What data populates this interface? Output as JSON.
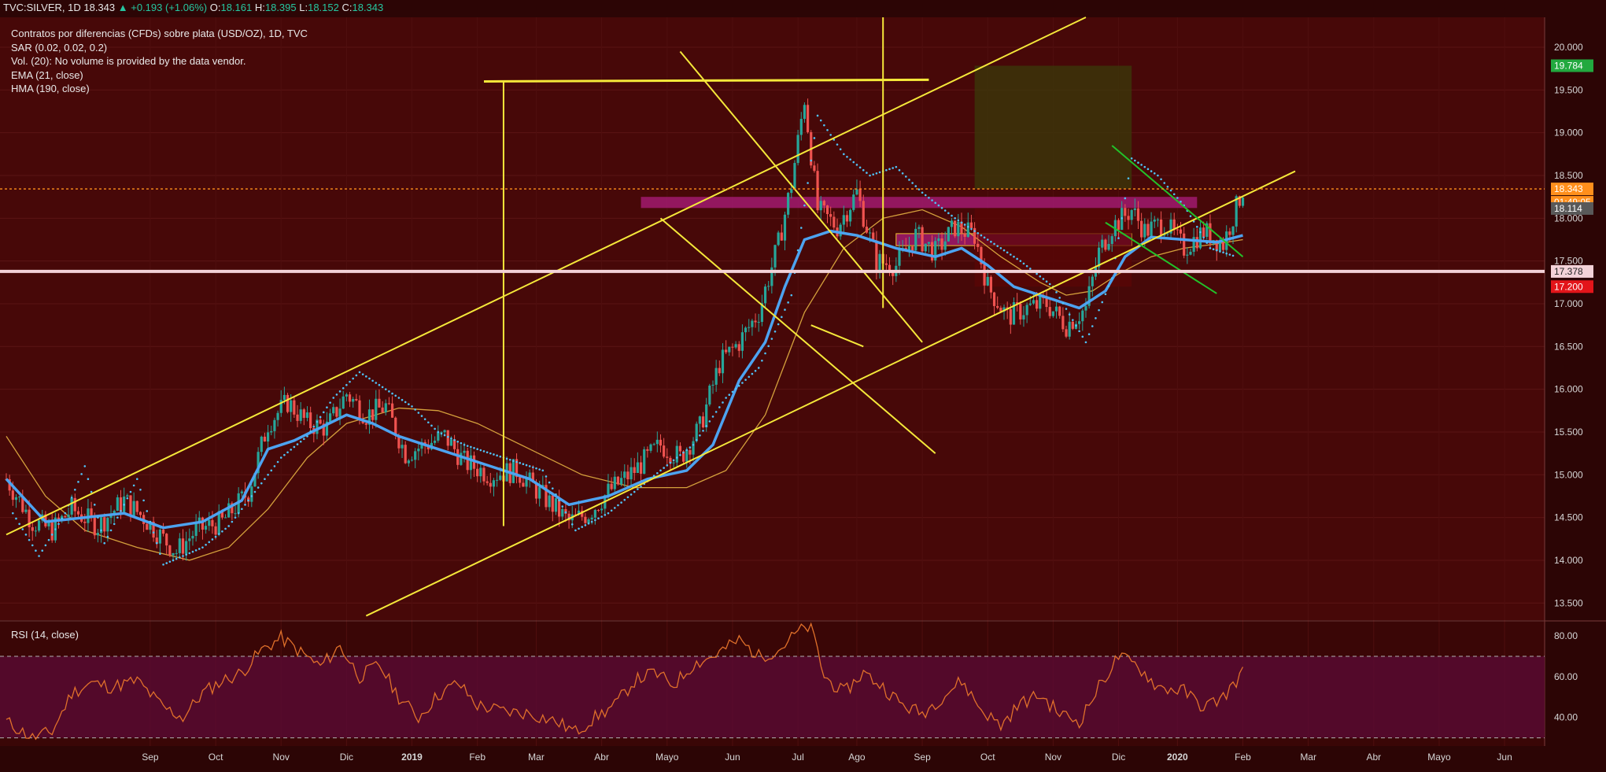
{
  "header": {
    "symbol": "TVC:SILVER, 1D",
    "last": "18.343",
    "change": "+0.193 (+1.06%)",
    "open_label": "O:",
    "open": "18.161",
    "high_label": "H:",
    "high": "18.395",
    "low_label": "L:",
    "low": "18.152",
    "close_label": "C:",
    "close": "18.343"
  },
  "legend": {
    "title": "Contratos por diferencias (CFDs) sobre plata (USD/OZ), 1D, TVC",
    "sar": "SAR (0.02, 0.02, 0.2)",
    "vol": "Vol. (20): No volume is provided by the data vendor.",
    "ema": "EMA (21, close)",
    "hma": "HMA (190, close)"
  },
  "rsi_title": "RSI (14, close)",
  "colors": {
    "background": "#2c0505",
    "up": "#26a69a",
    "down": "#ef5350",
    "ema": "#4da3f0",
    "hma": "#d4a03c",
    "sar": "#4fc3f7",
    "trendline": "#f5e83a",
    "rsi_line": "#e0702a",
    "support": "#f3d2d8"
  },
  "chart_data": [
    {
      "type": "candlestick",
      "title": "TVC:SILVER, 1D",
      "x_tick_labels": [
        "Sep",
        "Oct",
        "Nov",
        "Dic",
        "2019",
        "Feb",
        "Mar",
        "Abr",
        "Mayo",
        "Jun",
        "Jul",
        "Ago",
        "Sep",
        "Oct",
        "Nov",
        "Dic",
        "2020",
        "Feb",
        "Mar",
        "Abr",
        "Mayo",
        "Jun"
      ],
      "y_ticks": [
        "20.000",
        "19.500",
        "19.000",
        "18.500",
        "18.000",
        "17.500",
        "17.000",
        "16.500",
        "16.000",
        "15.500",
        "15.000",
        "14.500",
        "14.000",
        "13.500"
      ],
      "ylim": [
        13.3,
        20.35
      ],
      "price_markers": [
        {
          "label": "19.784",
          "value": 19.784,
          "color": "#22a93f",
          "text_color": "#ffffff"
        },
        {
          "label": "18.343",
          "value": 18.343,
          "color": "#ff8f1c",
          "text_color": "#ffffff"
        },
        {
          "label": "01:49:05",
          "value": 18.2,
          "color": "#ff8f1c",
          "text_color": "#ffffff"
        },
        {
          "label": "18.114",
          "value": 18.114,
          "color": "#595959",
          "text_color": "#ffffff"
        },
        {
          "label": "17.378",
          "value": 17.378,
          "color": "#f3d2d8",
          "text_color": "#222222"
        },
        {
          "label": "17.200",
          "value": 17.2,
          "color": "#e3151a",
          "text_color": "#ffffff"
        }
      ],
      "series": [
        {
          "name": "SAR (0.02, 0.02, 0.2)",
          "style": "dots"
        },
        {
          "name": "EMA (21, close)",
          "style": "line"
        },
        {
          "name": "HMA (190, close)",
          "style": "line"
        }
      ],
      "ohlc_path": [
        [
          0,
          14.95
        ],
        [
          4,
          14.45
        ],
        [
          7,
          14.35
        ],
        [
          10,
          14.6
        ],
        [
          14,
          14.4
        ],
        [
          18,
          14.7
        ],
        [
          21,
          14.5
        ],
        [
          24,
          14.25
        ],
        [
          26,
          14.1
        ],
        [
          29,
          14.35
        ],
        [
          33,
          14.45
        ],
        [
          37,
          14.8
        ],
        [
          40,
          15.6
        ],
        [
          43,
          15.85
        ],
        [
          46,
          15.6
        ],
        [
          49,
          15.55
        ],
        [
          52,
          15.95
        ],
        [
          55,
          15.7
        ],
        [
          58,
          15.8
        ],
        [
          61,
          15.25
        ],
        [
          64,
          15.35
        ],
        [
          67,
          15.45
        ],
        [
          70,
          15.15
        ],
        [
          74,
          15.0
        ],
        [
          78,
          15.05
        ],
        [
          82,
          14.75
        ],
        [
          86,
          14.45
        ],
        [
          89,
          14.55
        ],
        [
          92,
          14.8
        ],
        [
          96,
          15.05
        ],
        [
          100,
          15.35
        ],
        [
          103,
          15.2
        ],
        [
          106,
          15.55
        ],
        [
          109,
          16.3
        ],
        [
          112,
          16.55
        ],
        [
          115,
          16.9
        ],
        [
          118,
          17.7
        ],
        [
          120,
          18.4
        ],
        [
          122,
          19.4
        ],
        [
          124,
          18.1
        ],
        [
          127,
          17.9
        ],
        [
          130,
          18.3
        ],
        [
          133,
          17.5
        ],
        [
          136,
          17.45
        ],
        [
          139,
          17.8
        ],
        [
          142,
          17.6
        ],
        [
          145,
          17.9
        ],
        [
          148,
          17.8
        ],
        [
          150,
          17.2
        ],
        [
          153,
          16.85
        ],
        [
          156,
          16.95
        ],
        [
          159,
          17.0
        ],
        [
          162,
          16.75
        ],
        [
          165,
          16.95
        ],
        [
          167,
          17.6
        ],
        [
          169,
          17.9
        ],
        [
          172,
          18.1
        ],
        [
          174,
          17.85
        ],
        [
          177,
          17.95
        ],
        [
          180,
          17.65
        ],
        [
          183,
          17.85
        ],
        [
          186,
          17.7
        ],
        [
          189,
          18.34
        ]
      ],
      "ema_path": [
        [
          0,
          14.95
        ],
        [
          6,
          14.45
        ],
        [
          12,
          14.5
        ],
        [
          18,
          14.55
        ],
        [
          24,
          14.38
        ],
        [
          30,
          14.45
        ],
        [
          36,
          14.7
        ],
        [
          40,
          15.3
        ],
        [
          44,
          15.4
        ],
        [
          48,
          15.55
        ],
        [
          52,
          15.7
        ],
        [
          56,
          15.6
        ],
        [
          60,
          15.45
        ],
        [
          66,
          15.3
        ],
        [
          72,
          15.15
        ],
        [
          80,
          14.95
        ],
        [
          86,
          14.65
        ],
        [
          92,
          14.75
        ],
        [
          98,
          14.95
        ],
        [
          104,
          15.05
        ],
        [
          108,
          15.35
        ],
        [
          112,
          16.1
        ],
        [
          116,
          16.55
        ],
        [
          119,
          17.2
        ],
        [
          122,
          17.75
        ],
        [
          126,
          17.85
        ],
        [
          130,
          17.8
        ],
        [
          136,
          17.65
        ],
        [
          142,
          17.55
        ],
        [
          146,
          17.65
        ],
        [
          150,
          17.45
        ],
        [
          154,
          17.2
        ],
        [
          160,
          17.05
        ],
        [
          164,
          16.95
        ],
        [
          168,
          17.15
        ],
        [
          171,
          17.55
        ],
        [
          175,
          17.78
        ],
        [
          180,
          17.75
        ],
        [
          185,
          17.72
        ],
        [
          189,
          17.8
        ]
      ],
      "hma_path": [
        [
          0,
          15.45
        ],
        [
          6,
          14.75
        ],
        [
          12,
          14.35
        ],
        [
          20,
          14.15
        ],
        [
          28,
          14.0
        ],
        [
          34,
          14.15
        ],
        [
          40,
          14.6
        ],
        [
          46,
          15.2
        ],
        [
          52,
          15.6
        ],
        [
          60,
          15.78
        ],
        [
          66,
          15.75
        ],
        [
          72,
          15.6
        ],
        [
          80,
          15.3
        ],
        [
          88,
          15.0
        ],
        [
          96,
          14.85
        ],
        [
          104,
          14.85
        ],
        [
          110,
          15.05
        ],
        [
          116,
          15.7
        ],
        [
          122,
          16.9
        ],
        [
          128,
          17.65
        ],
        [
          134,
          18.0
        ],
        [
          140,
          18.1
        ],
        [
          146,
          17.9
        ],
        [
          152,
          17.55
        ],
        [
          158,
          17.25
        ],
        [
          162,
          17.1
        ],
        [
          166,
          17.15
        ],
        [
          170,
          17.35
        ],
        [
          175,
          17.55
        ],
        [
          180,
          17.65
        ],
        [
          185,
          17.7
        ],
        [
          189,
          17.75
        ]
      ],
      "sar_path": [
        [
          1,
          14.55
        ],
        [
          5,
          14.05
        ],
        [
          9,
          14.55
        ],
        [
          12,
          15.1
        ],
        [
          15,
          14.2
        ],
        [
          20,
          14.95
        ],
        [
          24,
          13.95
        ],
        [
          30,
          14.15
        ],
        [
          34,
          14.4
        ],
        [
          38,
          14.8
        ],
        [
          42,
          15.2
        ],
        [
          46,
          15.45
        ],
        [
          50,
          15.9
        ],
        [
          54,
          16.2
        ],
        [
          58,
          16.0
        ],
        [
          62,
          15.8
        ],
        [
          66,
          15.5
        ],
        [
          70,
          15.35
        ],
        [
          76,
          15.2
        ],
        [
          82,
          15.05
        ],
        [
          87,
          14.35
        ],
        [
          92,
          14.55
        ],
        [
          96,
          14.8
        ],
        [
          100,
          15.05
        ],
        [
          105,
          15.35
        ],
        [
          110,
          15.9
        ],
        [
          115,
          16.25
        ],
        [
          120,
          17.1
        ],
        [
          124,
          19.2
        ],
        [
          128,
          18.75
        ],
        [
          132,
          18.5
        ],
        [
          136,
          18.6
        ],
        [
          140,
          18.3
        ],
        [
          145,
          18.0
        ],
        [
          150,
          17.75
        ],
        [
          155,
          17.5
        ],
        [
          160,
          17.2
        ],
        [
          165,
          16.55
        ],
        [
          169,
          17.3
        ],
        [
          172,
          18.7
        ],
        [
          176,
          18.5
        ],
        [
          180,
          18.15
        ],
        [
          184,
          17.65
        ],
        [
          188,
          17.55
        ]
      ],
      "trendlines": [
        {
          "name": "channel-top",
          "points": [
            [
              0,
              14.3
            ],
            [
              165,
              20.35
            ]
          ]
        },
        {
          "name": "channel-bottom",
          "points": [
            [
              55,
              13.35
            ],
            [
              197,
              18.55
            ]
          ]
        },
        {
          "name": "resistance-horizontal",
          "points": [
            [
              73,
              19.6
            ],
            [
              141,
              19.62
            ]
          ]
        },
        {
          "name": "swing-high-vertical",
          "points": [
            [
              76,
              14.4
            ],
            [
              76,
              19.6
            ]
          ]
        },
        {
          "name": "breakout-vertical",
          "points": [
            [
              134,
              16.95
            ],
            [
              134,
              20.35
            ]
          ]
        },
        {
          "name": "wedge-top",
          "points": [
            [
              103,
              19.95
            ],
            [
              140,
              16.55
            ]
          ]
        },
        {
          "name": "wedge-bottom",
          "points": [
            [
              100,
              18.0
            ],
            [
              142,
              15.25
            ]
          ]
        },
        {
          "name": "wedge-base",
          "points": [
            [
              123,
              16.75
            ],
            [
              131,
              16.5
            ]
          ]
        }
      ],
      "zones": [
        {
          "name": "resistance-zone",
          "from": 97,
          "to": 182,
          "low": 18.12,
          "high": 18.25,
          "color": "#a11a6e"
        },
        {
          "name": "consolidation-zone",
          "from": 136,
          "to": 172,
          "low": 17.68,
          "high": 17.82,
          "color": "#a11a6e"
        },
        {
          "name": "target-zone",
          "from": 148,
          "to": 172,
          "low": 18.343,
          "high": 19.784,
          "color": "#3a3a0a"
        },
        {
          "name": "stop-zone",
          "from": 148,
          "to": 172,
          "low": 17.2,
          "high": 18.114,
          "color": "#5a0606"
        }
      ],
      "support_level": 17.378,
      "current_price": 18.343
    },
    {
      "type": "line",
      "title": "RSI (14, close)",
      "y_ticks": [
        "80.00",
        "60.00",
        "40.00"
      ],
      "ylim": [
        26,
        87
      ],
      "band": [
        30,
        70
      ],
      "rsi_path": [
        [
          0,
          38
        ],
        [
          4,
          30
        ],
        [
          7,
          33
        ],
        [
          10,
          52
        ],
        [
          13,
          57
        ],
        [
          16,
          55
        ],
        [
          20,
          58
        ],
        [
          24,
          45
        ],
        [
          27,
          40
        ],
        [
          30,
          52
        ],
        [
          33,
          58
        ],
        [
          36,
          62
        ],
        [
          39,
          73
        ],
        [
          42,
          79
        ],
        [
          45,
          72
        ],
        [
          48,
          65
        ],
        [
          51,
          75
        ],
        [
          54,
          60
        ],
        [
          57,
          66
        ],
        [
          60,
          50
        ],
        [
          63,
          40
        ],
        [
          66,
          51
        ],
        [
          69,
          57
        ],
        [
          72,
          46
        ],
        [
          76,
          43
        ],
        [
          80,
          42
        ],
        [
          84,
          38
        ],
        [
          87,
          33
        ],
        [
          90,
          40
        ],
        [
          93,
          46
        ],
        [
          96,
          58
        ],
        [
          99,
          62
        ],
        [
          102,
          56
        ],
        [
          105,
          66
        ],
        [
          108,
          70
        ],
        [
          112,
          78
        ],
        [
          115,
          70
        ],
        [
          118,
          73
        ],
        [
          121,
          82
        ],
        [
          123,
          85
        ],
        [
          125,
          60
        ],
        [
          128,
          52
        ],
        [
          131,
          62
        ],
        [
          134,
          55
        ],
        [
          137,
          46
        ],
        [
          140,
          42
        ],
        [
          143,
          50
        ],
        [
          146,
          58
        ],
        [
          149,
          44
        ],
        [
          152,
          36
        ],
        [
          155,
          47
        ],
        [
          158,
          51
        ],
        [
          161,
          42
        ],
        [
          164,
          38
        ],
        [
          167,
          55
        ],
        [
          170,
          70
        ],
        [
          173,
          65
        ],
        [
          176,
          55
        ],
        [
          180,
          53
        ],
        [
          183,
          45
        ],
        [
          186,
          50
        ],
        [
          189,
          62
        ]
      ]
    }
  ]
}
